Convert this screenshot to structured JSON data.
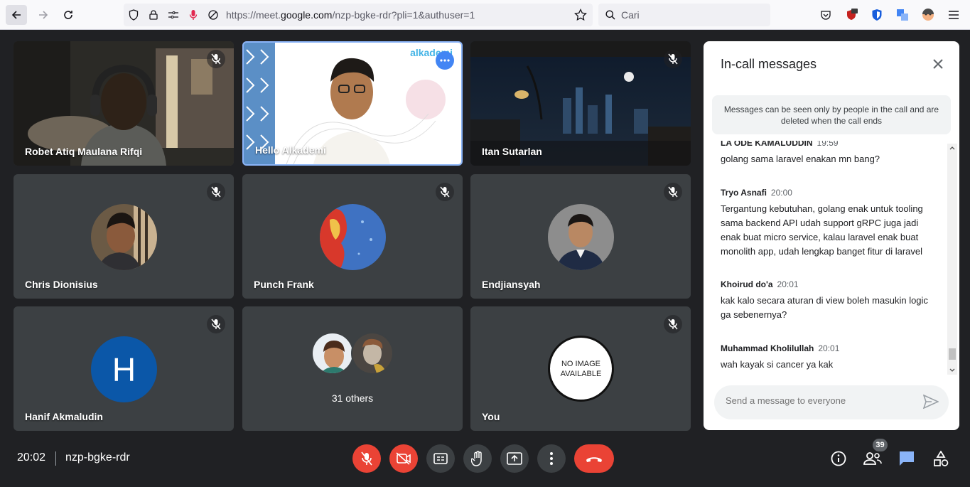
{
  "browser": {
    "url_prefix": "https://meet.",
    "url_domain": "google.com",
    "url_path": "/nzp-bgke-rdr?pli=1&authuser=1",
    "search_placeholder": "Cari"
  },
  "tiles": [
    {
      "name": "Robet Atiq Maulana Rifqi"
    },
    {
      "name": "Hello Alkademi",
      "logo_text": "alkademi"
    },
    {
      "name": "Itan Sutarlan"
    },
    {
      "name": "Chris Dionisius"
    },
    {
      "name": "Punch Frank"
    },
    {
      "name": "Endjiansyah"
    },
    {
      "name": "Hanif Akmaludin",
      "initial": "H"
    },
    {
      "name": "31 others"
    },
    {
      "name": "You",
      "no_image_text": "NO IMAGE AVAILABLE"
    }
  ],
  "panel": {
    "title": "In-call messages",
    "notice": "Messages can be seen only by people in the call and are deleted when the call ends",
    "messages": [
      {
        "sender": "LA ODE KAMALUDDIN",
        "time": "19:59",
        "text": "golang sama laravel enakan mn bang?"
      },
      {
        "sender": "Tryo Asnafi",
        "time": "20:00",
        "text": "Tergantung kebutuhan, golang enak untuk tooling sama backend API udah support gRPC juga jadi enak buat micro service, kalau laravel enak buat monolith app, udah lengkap banget fitur di laravel"
      },
      {
        "sender": "Khoirud do'a",
        "time": "20:01",
        "text": "kak kalo secara aturan di view boleh masukin logic ga sebenernya?"
      },
      {
        "sender": "Muhammad Kholilullah",
        "time": "20:01",
        "text": "wah kayak si cancer ya kak"
      }
    ],
    "input_placeholder": "Send a message to everyone"
  },
  "bottom": {
    "time": "20:02",
    "code": "nzp-bgke-rdr",
    "participants_count": "39"
  },
  "colors": {
    "background": "#202124",
    "tile": "#3c4043",
    "danger": "#ea4335",
    "accent": "#8ab4f8",
    "active_border": "#8ab4f8"
  }
}
